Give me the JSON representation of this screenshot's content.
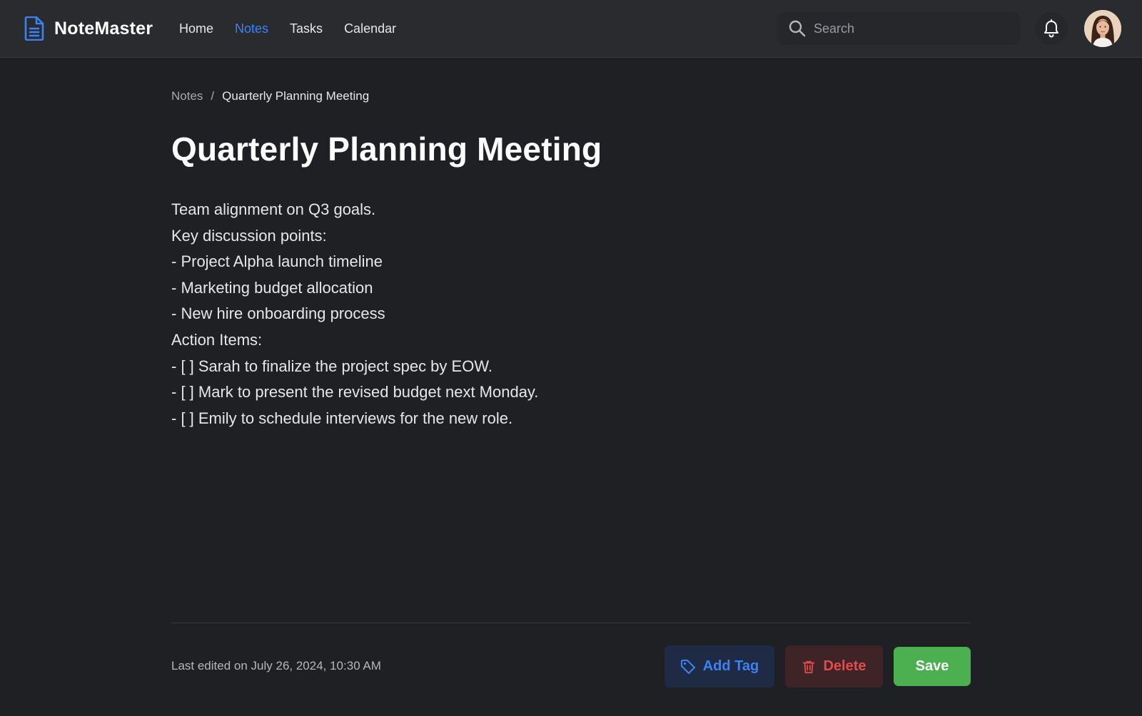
{
  "app": {
    "name": "NoteMaster",
    "accent_color": "#3b82f6"
  },
  "nav": {
    "items": [
      {
        "label": "Home",
        "active": false
      },
      {
        "label": "Notes",
        "active": true
      },
      {
        "label": "Tasks",
        "active": false
      },
      {
        "label": "Calendar",
        "active": false
      }
    ]
  },
  "search": {
    "placeholder": "Search",
    "value": ""
  },
  "icons": {
    "brand": "document-icon",
    "search": "search-icon",
    "notifications": "bell-icon",
    "tag": "tag-icon",
    "delete": "trash-icon"
  },
  "breadcrumb": {
    "parent": "Notes",
    "separator": "/",
    "current": "Quarterly Planning Meeting"
  },
  "note": {
    "title": "Quarterly Planning Meeting",
    "lines": [
      "Team alignment on Q3 goals.",
      "Key discussion points:",
      "- Project Alpha launch timeline",
      "- Marketing budget allocation",
      "- New hire onboarding process",
      "Action Items:",
      "- [ ] Sarah to finalize the project spec by EOW.",
      "- [ ] Mark to present the revised budget next Monday.",
      "- [ ] Emily to schedule interviews for the new role."
    ],
    "last_edited": "Last edited on July 26, 2024, 10:30 AM"
  },
  "actions": {
    "add_tag": "Add Tag",
    "delete": "Delete",
    "save": "Save"
  },
  "colors": {
    "background": "#1f2023",
    "topbar": "#2a2b2f",
    "save": "#4caf50",
    "delete": "#e24b4b",
    "link": "#3b82f6"
  }
}
